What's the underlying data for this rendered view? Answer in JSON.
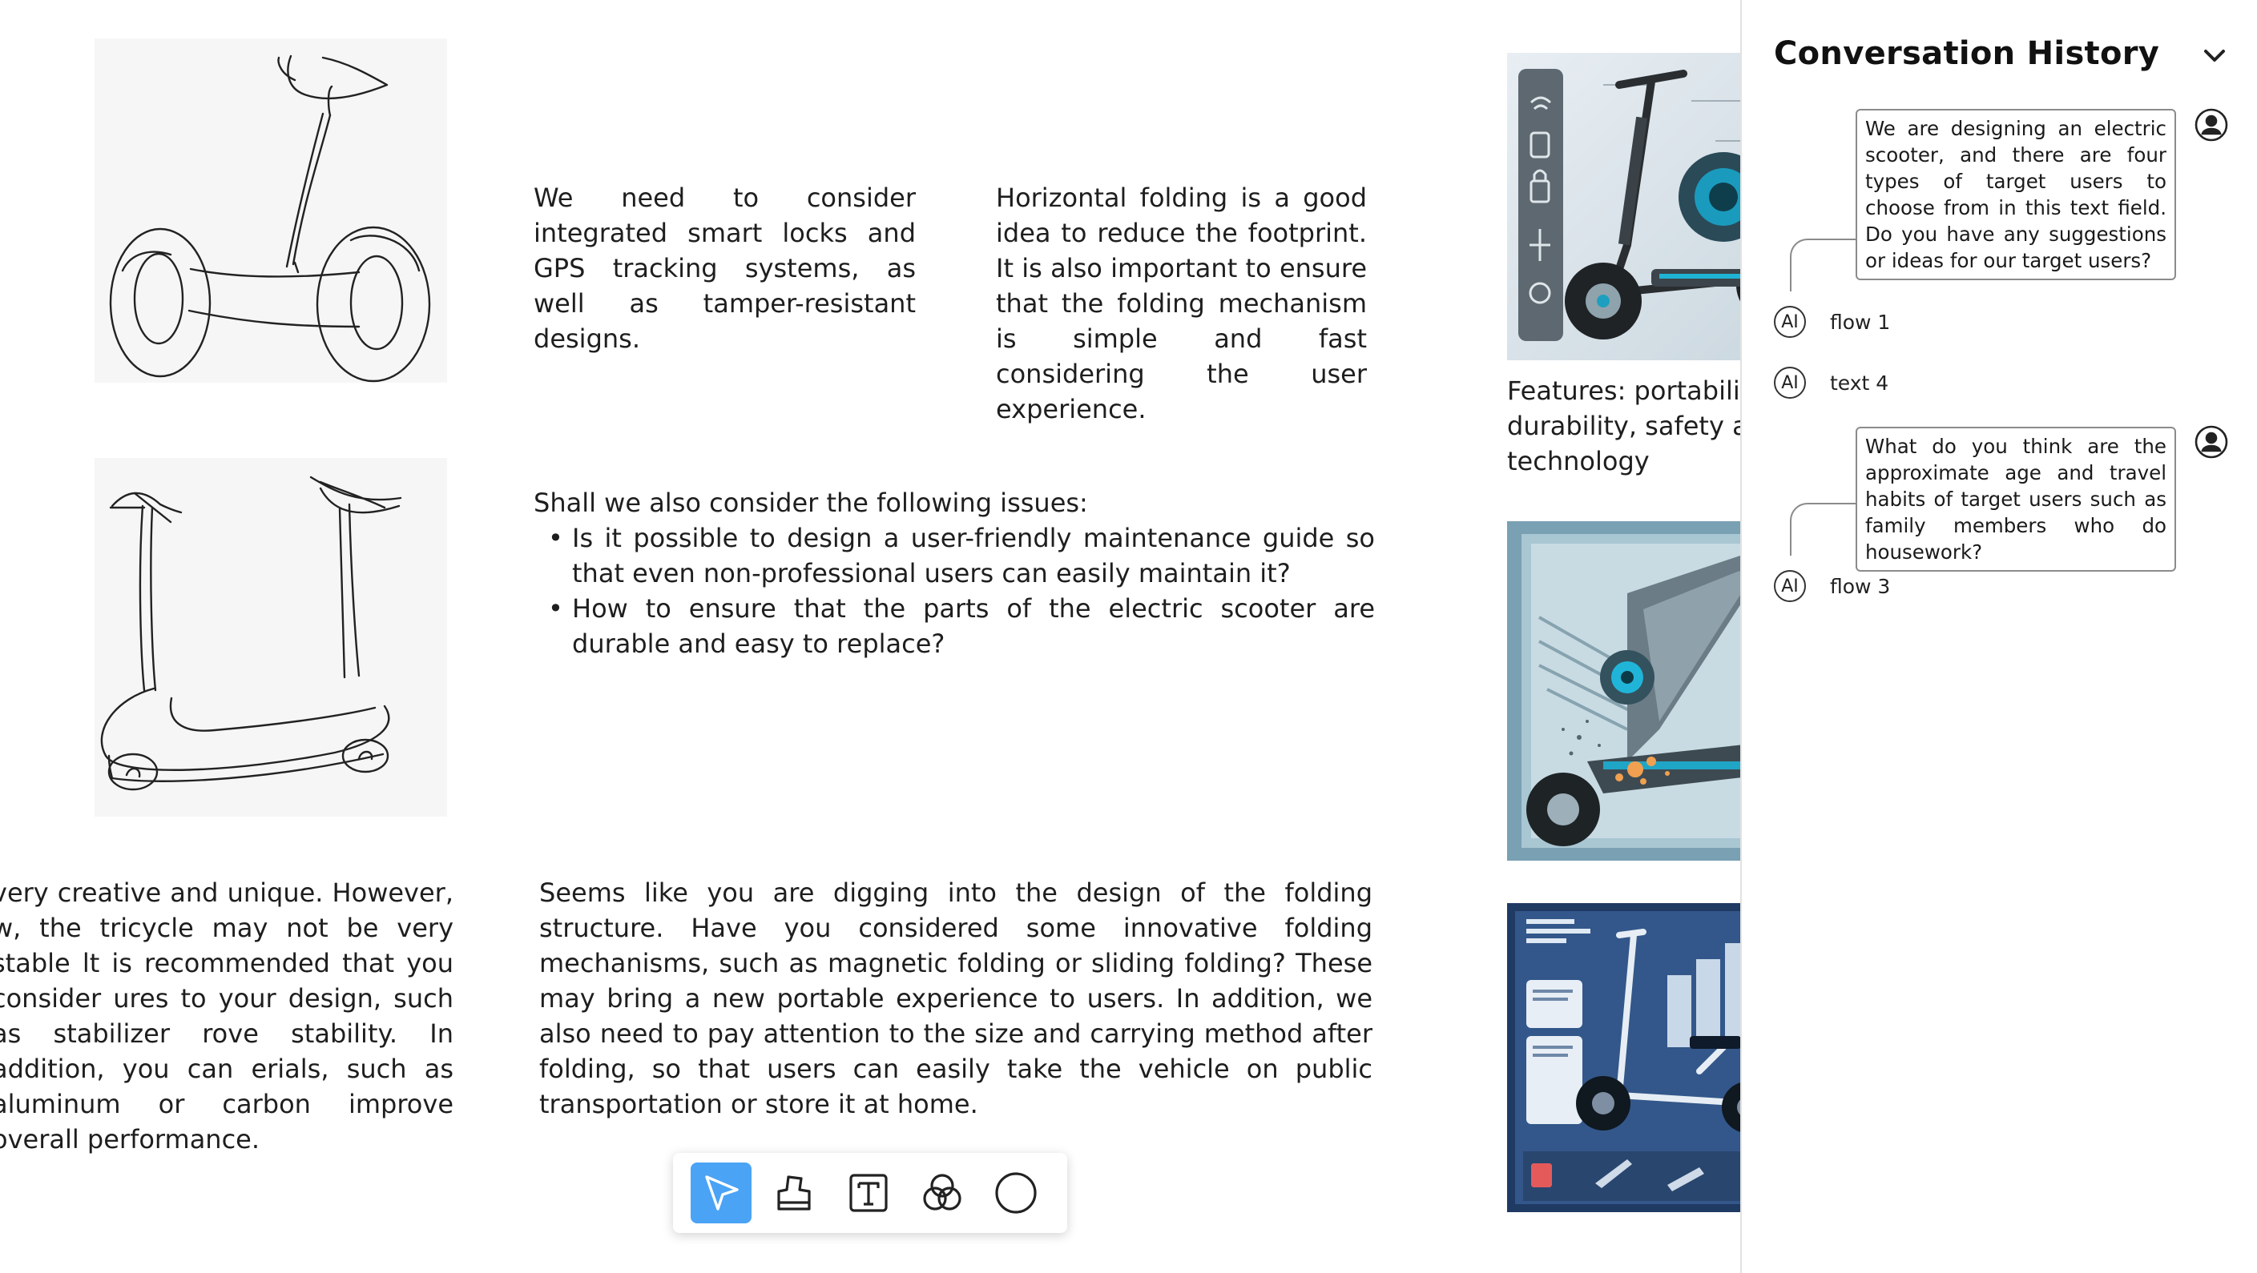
{
  "canvas": {
    "notes": {
      "smart_locks": "We need to consider integrated smart locks and GPS tracking systems, as well as tamper-resistant designs.",
      "folding": "Horizontal folding is a good idea to reduce the footprint. It is also important to ensure that the folding mechanism is simple and fast considering the user experience.",
      "issues_intro": "Shall we also consider the following issues:",
      "issues": [
        "Is it possible to design a user-friendly maintenance guide so that even non-professional users can easily maintain it?",
        "How to ensure that the parts of the electric scooter are durable and easy to replace?"
      ],
      "tricycle": "very creative and unique. However, w, the tricycle may not be very stable lt is recommended that you consider ures to your design, such as stabilizer rove stability. In addition, you can erials, such as aluminum or carbon improve overall performance.",
      "digging": "Seems like you are digging into the design of the folding structure. Have you considered some innovative folding mechanisms, such as magnetic folding or sliding folding? These may bring a new portable experience to users. In addition, we also need to pay attention to the size and carrying method after folding, so that users can easily take the vehicle on public transportation or store it at home.",
      "features": "Features: portabilit durability, safety ar smart technology"
    },
    "sketches": [
      "self-balancing-scooter-sketch",
      "folding-tricycle-scooter-sketch"
    ],
    "images": [
      "scooter-render-with-icons",
      "folding-scooter-exploded-render",
      "scooter-infographic-render"
    ]
  },
  "toolbar": {
    "tools": [
      {
        "name": "select",
        "icon": "cursor-arrow-icon",
        "active": true
      },
      {
        "name": "sticky",
        "icon": "stamp-icon",
        "active": false
      },
      {
        "name": "text",
        "icon": "text-box-icon",
        "active": false
      },
      {
        "name": "shapes",
        "icon": "overlap-circles-icon",
        "active": false
      },
      {
        "name": "circle",
        "icon": "circle-icon",
        "active": false
      }
    ],
    "colors": {
      "active_bg": "#4aa3f5"
    }
  },
  "sidebar": {
    "title": "Conversation History",
    "collapse_icon": "chevron-down-icon",
    "messages": [
      {
        "type": "user",
        "text": "We are designing an electric scooter, and there are four types of target users to choose from in this text field. Do you have any suggestions or ideas for our target users?"
      },
      {
        "type": "ai",
        "badge": "AI",
        "label": "flow 1"
      },
      {
        "type": "ai",
        "badge": "AI",
        "label": "text 4"
      },
      {
        "type": "user",
        "text": "What do you think are the approximate age and travel habits of target users such as family members who do housework?"
      },
      {
        "type": "ai",
        "badge": "AI",
        "label": "flow 3"
      }
    ]
  }
}
